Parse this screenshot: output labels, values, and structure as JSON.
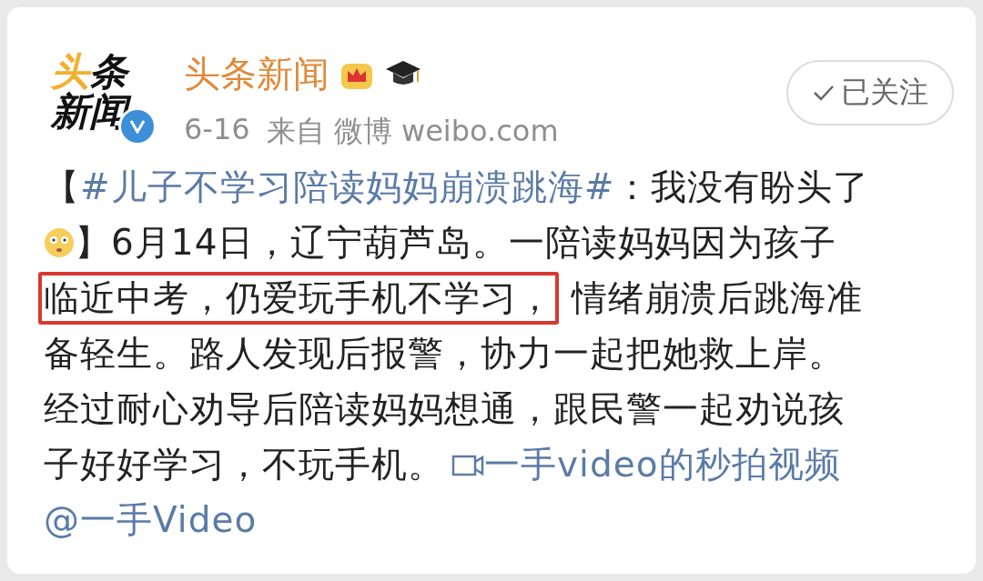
{
  "post": {
    "avatar": {
      "logo_lines": [
        "头条",
        "新闻"
      ],
      "verified": true
    },
    "author": "头条新闻",
    "date": "6-16",
    "source_prefix": "来自",
    "source": "微博 weibo.com",
    "follow_button": {
      "label": "已关注",
      "followed": true
    },
    "body": [
      {
        "kind": "text",
        "text": "【"
      },
      {
        "kind": "hashtag",
        "text": "#儿子不学习陪读妈妈崩溃跳海#"
      },
      {
        "kind": "text",
        "text": "：我没有盼头了"
      },
      {
        "kind": "break"
      },
      {
        "kind": "emoji"
      },
      {
        "kind": "text",
        "text": "】6月14日，辽宁葫芦岛。一陪读妈妈因为孩子"
      },
      {
        "kind": "break"
      },
      {
        "kind": "highlight",
        "text": "临近中考，仍爱玩手机不学习，"
      },
      {
        "kind": "text",
        "text": "情绪崩溃后跳海准"
      },
      {
        "kind": "break"
      },
      {
        "kind": "text",
        "text": "备轻生。路人发现后报警，协力一起把她救上岸。"
      },
      {
        "kind": "break"
      },
      {
        "kind": "text",
        "text": "经过耐心劝导后陪读妈妈想通，跟民警一起劝说孩"
      },
      {
        "kind": "break"
      },
      {
        "kind": "text",
        "text": "子好好学习，不玩手机。"
      },
      {
        "kind": "video_link",
        "text": "一手video的秒拍视频"
      },
      {
        "kind": "break"
      },
      {
        "kind": "mention",
        "text": "@一手Video"
      }
    ]
  }
}
